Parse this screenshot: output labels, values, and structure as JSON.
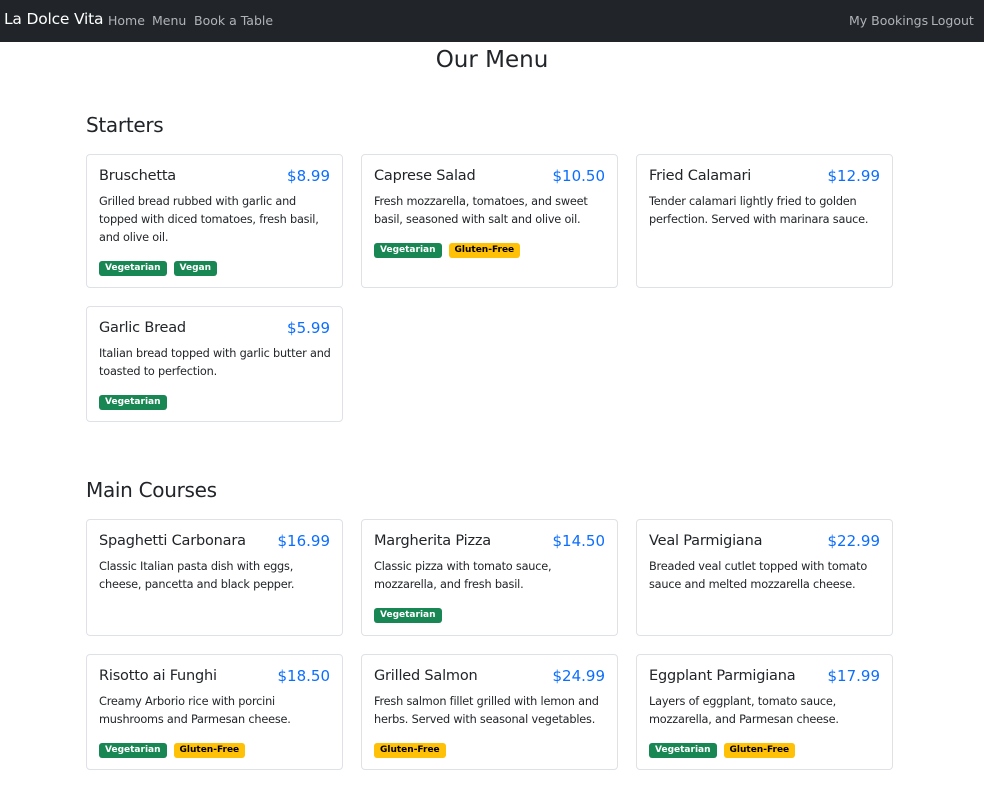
{
  "nav": {
    "brand": "La Dolce Vita",
    "links": [
      "Home",
      "Menu",
      "Book a Table"
    ],
    "right_links": [
      "My Bookings",
      "Logout"
    ]
  },
  "page_title": "Our Menu",
  "sections": [
    {
      "title": "Starters",
      "items": [
        {
          "name": "Bruschetta",
          "price": "$8.99",
          "desc": "Grilled bread rubbed with garlic and topped with diced tomatoes, fresh basil, and olive oil.",
          "badges": [
            "Vegetarian",
            "Vegan"
          ]
        },
        {
          "name": "Caprese Salad",
          "price": "$10.50",
          "desc": "Fresh mozzarella, tomatoes, and sweet basil, seasoned with salt and olive oil.",
          "badges": [
            "Vegetarian",
            "Gluten-Free"
          ]
        },
        {
          "name": "Fried Calamari",
          "price": "$12.99",
          "desc": "Tender calamari lightly fried to golden perfection. Served with marinara sauce.",
          "badges": []
        },
        {
          "name": "Garlic Bread",
          "price": "$5.99",
          "desc": "Italian bread topped with garlic butter and toasted to perfection.",
          "badges": [
            "Vegetarian"
          ]
        }
      ]
    },
    {
      "title": "Main Courses",
      "items": [
        {
          "name": "Spaghetti Carbonara",
          "price": "$16.99",
          "desc": "Classic Italian pasta dish with eggs, cheese, pancetta and black pepper.",
          "badges": []
        },
        {
          "name": "Margherita Pizza",
          "price": "$14.50",
          "desc": "Classic pizza with tomato sauce, mozzarella, and fresh basil.",
          "badges": [
            "Vegetarian"
          ]
        },
        {
          "name": "Veal Parmigiana",
          "price": "$22.99",
          "desc": "Breaded veal cutlet topped with tomato sauce and melted mozzarella cheese.",
          "badges": []
        },
        {
          "name": "Risotto ai Funghi",
          "price": "$18.50",
          "desc": "Creamy Arborio rice with porcini mushrooms and Parmesan cheese.",
          "badges": [
            "Vegetarian",
            "Gluten-Free"
          ]
        },
        {
          "name": "Grilled Salmon",
          "price": "$24.99",
          "desc": "Fresh salmon fillet grilled with lemon and herbs. Served with seasonal vegetables.",
          "badges": [
            "Gluten-Free"
          ]
        },
        {
          "name": "Eggplant Parmigiana",
          "price": "$17.99",
          "desc": "Layers of eggplant, tomato sauce, mozzarella, and Parmesan cheese.",
          "badges": [
            "Vegetarian",
            "Gluten-Free"
          ]
        }
      ]
    }
  ],
  "colors": {
    "navbar": "#212529",
    "price": "#0d6efd",
    "vegetarian_badge": "#198754",
    "gluten_free_badge": "#ffc107"
  }
}
